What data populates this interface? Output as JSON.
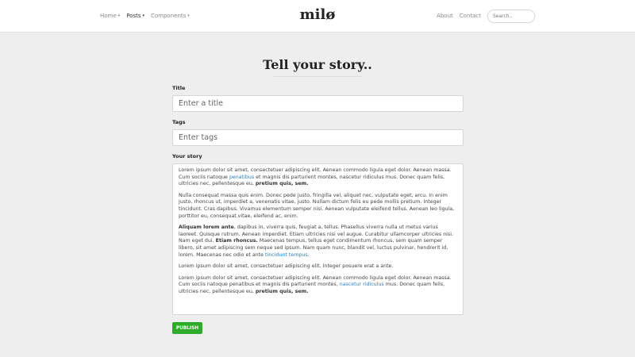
{
  "navbar": {
    "left_items": [
      {
        "label": "Home",
        "caret": "▾"
      },
      {
        "label": "Posts",
        "caret": "▾"
      },
      {
        "label": "Components",
        "caret": "▾"
      }
    ],
    "brand": "milø",
    "right_items": [
      {
        "label": "About"
      },
      {
        "label": "Contact"
      }
    ],
    "search_placeholder": "Search.."
  },
  "form": {
    "heading": "Tell your story..",
    "title_label": "Title",
    "title_placeholder": "Enter a title",
    "tags_label": "Tags",
    "tags_placeholder": "Enter tags",
    "story_label": "Your story",
    "publish_label": "PUBLISH"
  },
  "story": {
    "p1": {
      "t1": "Lorem ipsum dolor sit amet, consectetuer adipiscing elit. Aenean commodo ligula eget dolor. Aenean massa. Cum sociis natoque ",
      "link1": "penatibus",
      "t2": " et magnis dis parturient montes, nascetur ridiculus mus. Donec quam felis, ultricies nec, pellentesque eu, ",
      "bold1": "pretium quis, sem."
    },
    "p2": "Nulla consequat massa quis enim. Donec pede justo, fringilla vel, aliquet nec, vulputate eget, arcu. In enim justo, rhoncus ut, imperdiet a, venenatis vitae, justo. Nullam dictum felis eu pede mollis pretium. Integer tincidunt. Cras dapibus. Vivamus elementum semper nisi. Aenean vulputate eleifend tellus. Aenean leo ligula, porttitor eu, consequat vitae, eleifend ac, enim.",
    "p3": {
      "bold1": "Aliquam lorem ante",
      "t1": ", dapibus in, viverra quis, feugiat a, tellus. Phasellus viverra nulla ut metus varius laoreet. Quisque rutrum. Aenean imperdiet. Etiam ultricies nisi vel augue. Curabitur ullamcorper ultricies nisi. Nam eget dui. ",
      "bold2": "Etiam rhoncus.",
      "t2": " Maecenas tempus, tellus eget condimentum rhoncus, sem quam semper libero, sit amet adipiscing sem neque sed ipsum. Nam quam nunc, blandit vel, luctus pulvinar, hendrerit id, lorem. Maecenas nec odio et ante ",
      "link1": "tincidunt tempus",
      "t3": "."
    },
    "p4": "Lorem ipsum dolor sit amet, consectetuer adipiscing elit. Integer posuere erat a ante.",
    "p5": {
      "t1": "Lorem ipsum dolor sit amet, consectetuer adipiscing elit. Aenean commodo ligula eget dolor. Aenean massa. Cum sociis natoque penatibus et magnis dis parturient montes, ",
      "link1": "nascetur ridiculus",
      "t2": " mus. Donec quam felis, ultricies nec, pellentesque eu, ",
      "bold1": "pretium quis, sem."
    }
  },
  "colors": {
    "accent_link": "#2a7fc3",
    "publish_green": "#2eab2a",
    "page_bg": "#eeeeef"
  }
}
